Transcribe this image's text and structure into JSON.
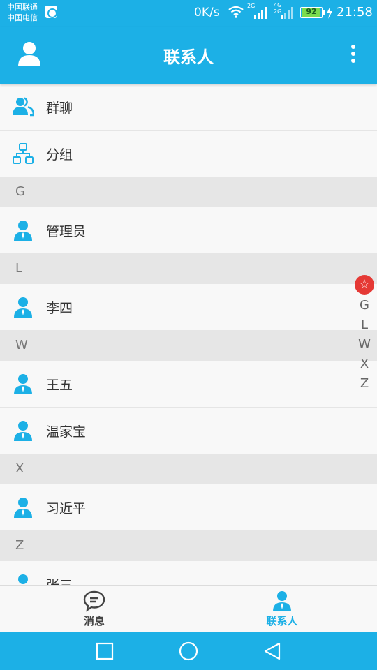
{
  "status_bar": {
    "carrier_1": "中国联通",
    "carrier_2": "中国电信",
    "net_speed": "0K/s",
    "sim1_type": "2G",
    "sim2_type_top": "4G",
    "sim2_type_bottom": "2G",
    "battery_level": "92",
    "battery_fraction": 0.92,
    "time": "21:58"
  },
  "app_bar": {
    "title": "联系人",
    "avatar_icon": "person-icon",
    "menu_icon": "more-vert-icon"
  },
  "contacts": {
    "shortcuts": [
      {
        "label": "群聊",
        "icon": "group-chat-icon"
      },
      {
        "label": "分组",
        "icon": "org-group-icon"
      }
    ],
    "sections": [
      {
        "letter": "G",
        "items": [
          "管理员"
        ]
      },
      {
        "letter": "L",
        "items": [
          "李四"
        ]
      },
      {
        "letter": "W",
        "items": [
          "王五",
          "温家宝"
        ]
      },
      {
        "letter": "X",
        "items": [
          "习近平"
        ]
      },
      {
        "letter": "Z",
        "items": [
          "张三"
        ]
      }
    ]
  },
  "index_bar": {
    "star": "☆",
    "letters": [
      "G",
      "L",
      "W",
      "X",
      "Z"
    ]
  },
  "tab_bar": {
    "tabs": [
      {
        "label": "消息",
        "icon": "chat-bubble-icon",
        "active": false
      },
      {
        "label": "联系人",
        "icon": "contact-person-icon",
        "active": true
      }
    ]
  },
  "colors": {
    "primary": "#1cb0e6",
    "section_bg": "#e6e6e6",
    "star_badge": "#e53935"
  }
}
